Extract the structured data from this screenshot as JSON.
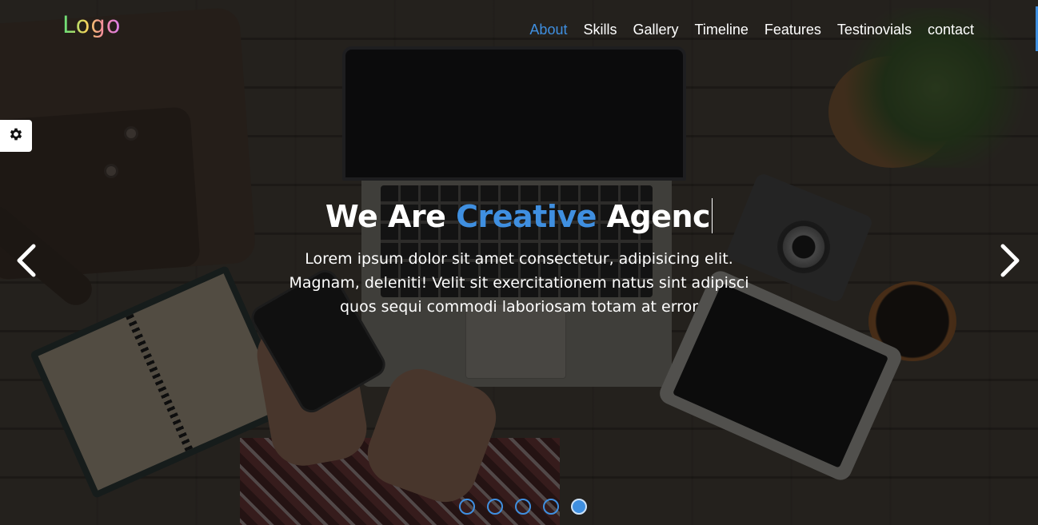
{
  "header": {
    "logo_text": "Logo",
    "nav": [
      {
        "label": "About",
        "active": true
      },
      {
        "label": "Skills",
        "active": false
      },
      {
        "label": "Gallery",
        "active": false
      },
      {
        "label": "Timeline",
        "active": false
      },
      {
        "label": "Features",
        "active": false
      },
      {
        "label": "Testinovials",
        "active": false
      },
      {
        "label": "contact",
        "active": false
      }
    ]
  },
  "settings": {
    "icon": "gear-icon"
  },
  "hero": {
    "title_prefix": "We Are",
    "title_highlight": "Creative",
    "title_suffix": "Agenc",
    "text_lines": [
      "Lorem ipsum dolor sit amet consectetur, adipisicing elit.",
      "Magnam, deleniti! Velit sit exercitationem natus sint adipisci",
      "quos sequi commodi laboriosam totam at error"
    ]
  },
  "carousel": {
    "prev_icon": "chevron-left-icon",
    "next_icon": "chevron-right-icon",
    "slide_count": 5,
    "active_slide": 5
  },
  "colors": {
    "accent": "#3f8fe0",
    "text": "#ffffff",
    "overlay": "#0a0a0c"
  }
}
